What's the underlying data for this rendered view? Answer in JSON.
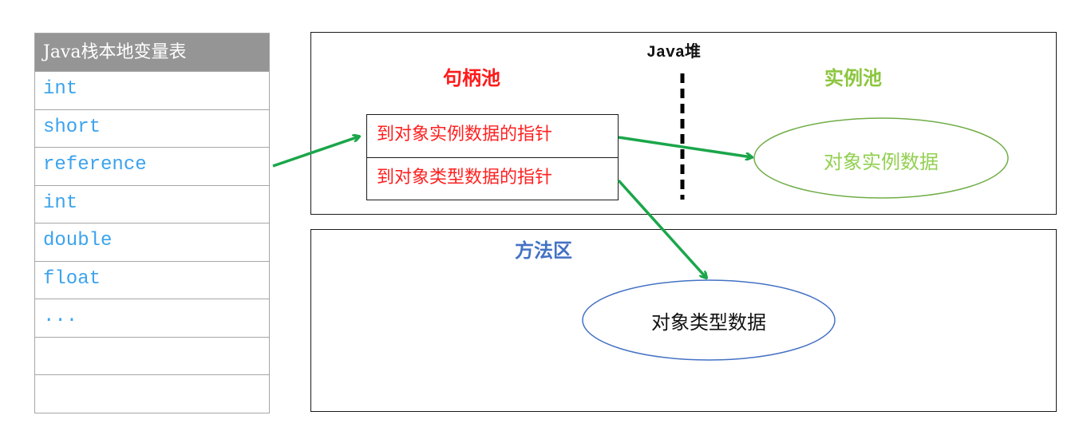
{
  "stack_table": {
    "header": "Java栈本地变量表",
    "rows": [
      "int",
      "short",
      "reference",
      "int",
      "double",
      "float",
      "...",
      "",
      ""
    ]
  },
  "heap": {
    "title": "Java堆",
    "handle_pool": {
      "title": "句柄池",
      "pointers": [
        "到对象实例数据的指针",
        "到对象类型数据的指针"
      ]
    },
    "instance_pool": {
      "title": "实例池",
      "object": "对象实例数据"
    }
  },
  "method_area": {
    "title": "方法区",
    "object": "对象类型数据"
  },
  "colors": {
    "arrow": "#1aa64a",
    "handle_text": "#ff1a1a",
    "instance_text": "#92d050",
    "instance_ellipse": "#70ad47",
    "method_title": "#4472c4",
    "method_ellipse": "#4472c4",
    "stack_header_bg": "#959595",
    "stack_row_text": "#3ba3ee"
  }
}
